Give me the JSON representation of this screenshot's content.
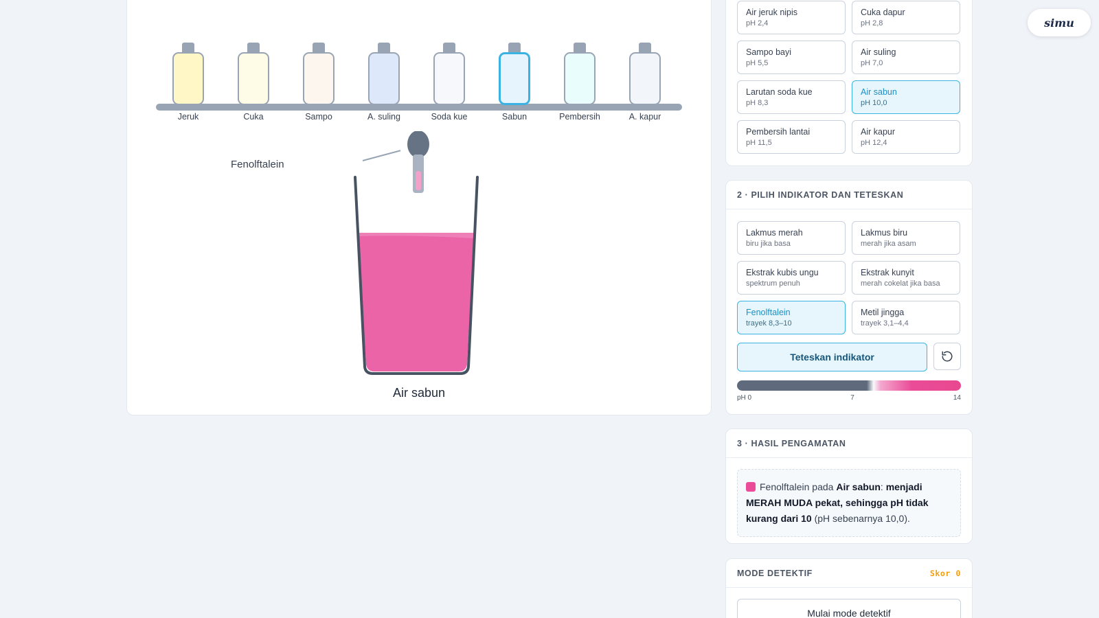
{
  "lab": {
    "bottles": [
      {
        "label": "Jeruk",
        "fill": "#fff8c6"
      },
      {
        "label": "Cuka",
        "fill": "#fefbe6"
      },
      {
        "label": "Sampo",
        "fill": "#fdf6ef"
      },
      {
        "label": "A. suling",
        "fill": "#dde9fb"
      },
      {
        "label": "Soda kue",
        "fill": "#f6f8fb"
      },
      {
        "label": "Sabun",
        "fill": "#e6f4fd",
        "selected": true
      },
      {
        "label": "Pembersih",
        "fill": "#eafdfd"
      },
      {
        "label": "A. kapur",
        "fill": "#f2f5f9"
      }
    ],
    "indicator_label": "Fenolftalein",
    "beaker_label": "Air sabun",
    "liquid_color": "#ec64a8"
  },
  "solutions": {
    "options": [
      {
        "name": "Air jeruk nipis",
        "sub": "pH 2,4"
      },
      {
        "name": "Cuka dapur",
        "sub": "pH 2,8"
      },
      {
        "name": "Sampo bayi",
        "sub": "pH 5,5"
      },
      {
        "name": "Air suling",
        "sub": "pH 7,0"
      },
      {
        "name": "Larutan soda kue",
        "sub": "pH 8,3"
      },
      {
        "name": "Air sabun",
        "sub": "pH 10,0",
        "active": true
      },
      {
        "name": "Pembersih lantai",
        "sub": "pH 11,5"
      },
      {
        "name": "Air kapur",
        "sub": "pH 12,4"
      }
    ]
  },
  "indicator_panel": {
    "title": "2 · PILIH INDIKATOR DAN TETESKAN",
    "options": [
      {
        "name": "Lakmus merah",
        "sub": "biru jika basa"
      },
      {
        "name": "Lakmus biru",
        "sub": "merah jika asam"
      },
      {
        "name": "Ekstrak kubis ungu",
        "sub": "spektrum penuh"
      },
      {
        "name": "Ekstrak kunyit",
        "sub": "merah cokelat jika basa"
      },
      {
        "name": "Fenolftalein",
        "sub": "trayek 8,3–10",
        "active": true
      },
      {
        "name": "Metil jingga",
        "sub": "trayek 3,1–4,4"
      }
    ],
    "drop_button": "Teteskan indikator",
    "scale": {
      "min": "pH 0",
      "mid": "7",
      "max": "14"
    }
  },
  "result_panel": {
    "title": "3 · HASIL PENGAMATAN",
    "swatch_color": "#ea4c98",
    "indicator": "Fenolftalein",
    "pada": " pada ",
    "solution": "Air sabun",
    "colon": ": ",
    "conclusion": "menjadi MERAH MUDA pekat, sehingga pH tidak kurang dari 10",
    "actual": " (pH sebenarnya 10,0)."
  },
  "detective": {
    "title": "MODE DETEKTIF",
    "score": "Skor 0",
    "start_button": "Mulai mode detektif"
  },
  "brand": {
    "logo": "simu"
  }
}
